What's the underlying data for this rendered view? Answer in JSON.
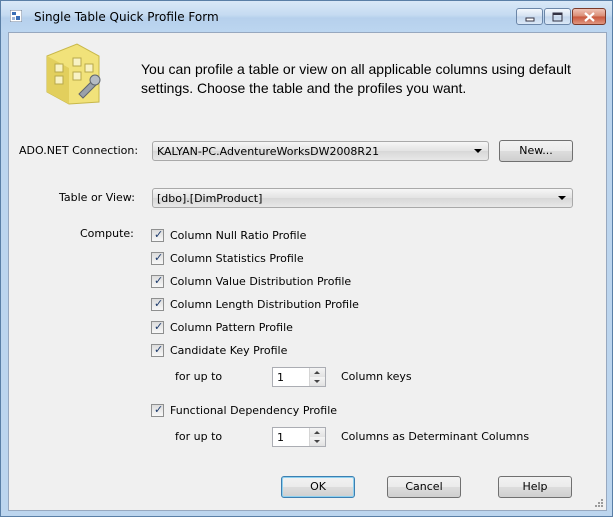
{
  "window": {
    "title": "Single Table Quick Profile Form"
  },
  "intro": {
    "text": "You can profile a table or view on all applicable columns using default settings. Choose the table and the profiles you want."
  },
  "connection": {
    "label": "ADO.NET Connection:",
    "value": "KALYAN-PC.AdventureWorksDW2008R21",
    "new_button": "New..."
  },
  "table": {
    "label": "Table or View:",
    "value": "[dbo].[DimProduct]"
  },
  "compute": {
    "label": "Compute:",
    "profiles": [
      {
        "label": "Column Null Ratio Profile",
        "checked": true
      },
      {
        "label": "Column Statistics Profile",
        "checked": true
      },
      {
        "label": "Column Value Distribution Profile",
        "checked": true
      },
      {
        "label": "Column Length Distribution Profile",
        "checked": true
      },
      {
        "label": "Column Pattern Profile",
        "checked": true
      },
      {
        "label": "Candidate Key Profile",
        "checked": true
      }
    ],
    "candidate_key": {
      "for_up_to": "for up to",
      "value": "1",
      "suffix": "Column keys"
    },
    "functional_dependency": {
      "label": "Functional Dependency Profile",
      "checked": true,
      "for_up_to": "for up to",
      "value": "1",
      "suffix": "Columns as Determinant Columns"
    }
  },
  "buttons": {
    "ok": "OK",
    "cancel": "Cancel",
    "help": "Help"
  },
  "colors": {
    "title_bar": "#c5dbf1",
    "client_bg": "#f0f0f0",
    "close_button": "#c8553a"
  }
}
